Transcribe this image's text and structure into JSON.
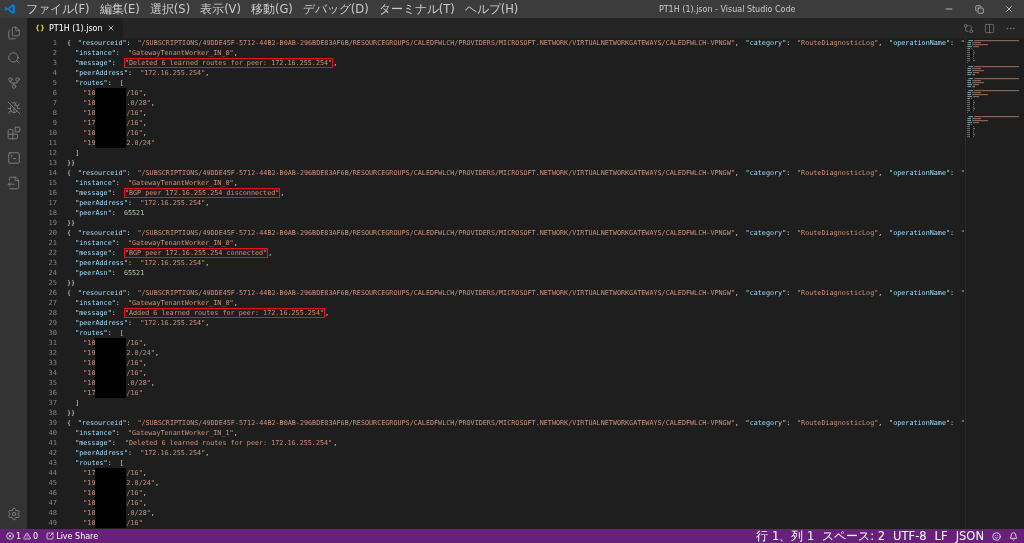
{
  "window": {
    "title": "PT1H (1).json - Visual Studio Code"
  },
  "menu": [
    "ファイル(F)",
    "編集(E)",
    "選択(S)",
    "表示(V)",
    "移動(G)",
    "デバッグ(D)",
    "ターミナル(T)",
    "ヘルプ(H)"
  ],
  "tabs": [
    {
      "icon": "{}",
      "label": "PT1H (1).json",
      "selected": true
    }
  ],
  "lines": [
    {
      "number": "1",
      "tokens": [
        {
          "kind": "punct",
          "text": "{"
        },
        {
          "kind": "indent"
        },
        {
          "kind": "key",
          "text": "\"resourceid\""
        },
        {
          "kind": "punct",
          "text": ":"
        },
        {
          "kind": "indent"
        },
        {
          "kind": "string",
          "text": "\"/SUBSCRIPTIONS/49DDE45F-5712-44B2-B0AB-296BDE83AF6B/RESOURCEGROUPS/CALEDFWLCH/PROVIDERS/MICROSOFT.NETWORK/VIRTUALNETWORKGATEWAYS/CALEDFWLCH-VPNGW\""
        },
        {
          "kind": "punct",
          "text": ","
        },
        {
          "kind": "indent"
        },
        {
          "kind": "key",
          "text": "\"category\""
        },
        {
          "kind": "punct",
          "text": ":"
        },
        {
          "kind": "indent"
        },
        {
          "kind": "string",
          "text": "\"RouteDiagnosticLog\""
        },
        {
          "kind": "punct",
          "text": ","
        },
        {
          "kind": "indent"
        },
        {
          "kind": "key",
          "text": "\"operationName\""
        },
        {
          "kind": "punct",
          "text": ":"
        },
        {
          "kind": "indent"
        },
        {
          "kind": "string",
          "text": "\""
        }
      ]
    },
    {
      "number": "2",
      "tokens": [
        {
          "kind": "indent"
        },
        {
          "kind": "key",
          "text": "\"instance\""
        },
        {
          "kind": "punct",
          "text": ":"
        },
        {
          "kind": "indent"
        },
        {
          "kind": "string",
          "text": "\"GatewayTenantWorker_IN_0\""
        },
        {
          "kind": "punct",
          "text": ","
        }
      ]
    },
    {
      "number": "3",
      "tokens": [
        {
          "kind": "indent"
        },
        {
          "kind": "key",
          "text": "\"message\""
        },
        {
          "kind": "punct",
          "text": ":"
        },
        {
          "kind": "indent"
        },
        {
          "kind": "string",
          "text": "\"Deleted 6 learned routes for peer: 172.16.255.254\"",
          "boxed": true
        },
        {
          "kind": "punct",
          "text": ","
        }
      ]
    },
    {
      "number": "4",
      "tokens": [
        {
          "kind": "indent"
        },
        {
          "kind": "key",
          "text": "\"peerAddress\""
        },
        {
          "kind": "punct",
          "text": ":"
        },
        {
          "kind": "indent"
        },
        {
          "kind": "string",
          "text": "\"172.16.255.254\""
        },
        {
          "kind": "punct",
          "text": ","
        }
      ]
    },
    {
      "number": "5",
      "tokens": [
        {
          "kind": "indent"
        },
        {
          "kind": "key",
          "text": "\"routes\""
        },
        {
          "kind": "punct",
          "text": ":"
        },
        {
          "kind": "indent"
        },
        {
          "kind": "punct",
          "text": "["
        }
      ]
    },
    {
      "number": "6",
      "tokens": [
        {
          "kind": "indent"
        },
        {
          "kind": "indent"
        },
        {
          "kind": "string",
          "text": "\"10"
        },
        {
          "kind": "redacted"
        },
        {
          "kind": "string",
          "text": "/16\""
        },
        {
          "kind": "punct",
          "text": ","
        }
      ]
    },
    {
      "number": "7",
      "tokens": [
        {
          "kind": "indent"
        },
        {
          "kind": "indent"
        },
        {
          "kind": "string",
          "text": "\"10"
        },
        {
          "kind": "redacted"
        },
        {
          "kind": "string",
          "text": ".0/28\""
        },
        {
          "kind": "punct",
          "text": ","
        }
      ]
    },
    {
      "number": "8",
      "tokens": [
        {
          "kind": "indent"
        },
        {
          "kind": "indent"
        },
        {
          "kind": "string",
          "text": "\"10"
        },
        {
          "kind": "redacted"
        },
        {
          "kind": "string",
          "text": "/16\""
        },
        {
          "kind": "punct",
          "text": ","
        }
      ]
    },
    {
      "number": "9",
      "tokens": [
        {
          "kind": "indent"
        },
        {
          "kind": "indent"
        },
        {
          "kind": "string",
          "text": "\"17"
        },
        {
          "kind": "redacted"
        },
        {
          "kind": "string",
          "text": "/16\""
        },
        {
          "kind": "punct",
          "text": ","
        }
      ]
    },
    {
      "number": "10",
      "tokens": [
        {
          "kind": "indent"
        },
        {
          "kind": "indent"
        },
        {
          "kind": "string",
          "text": "\"10"
        },
        {
          "kind": "redacted"
        },
        {
          "kind": "string",
          "text": "/16\""
        },
        {
          "kind": "punct",
          "text": ","
        }
      ]
    },
    {
      "number": "11",
      "tokens": [
        {
          "kind": "indent"
        },
        {
          "kind": "indent"
        },
        {
          "kind": "string",
          "text": "\"19"
        },
        {
          "kind": "redacted"
        },
        {
          "kind": "string",
          "text": "2.0/24\""
        }
      ]
    },
    {
      "number": "12",
      "tokens": [
        {
          "kind": "indent"
        },
        {
          "kind": "punct",
          "text": "]"
        }
      ]
    },
    {
      "number": "13",
      "tokens": [
        {
          "kind": "punct",
          "text": "}}"
        }
      ]
    },
    {
      "number": "14",
      "tokens": [
        {
          "kind": "punct",
          "text": "{"
        },
        {
          "kind": "indent"
        },
        {
          "kind": "key",
          "text": "\"resourceid\""
        },
        {
          "kind": "punct",
          "text": ":"
        },
        {
          "kind": "indent"
        },
        {
          "kind": "string",
          "text": "\"/SUBSCRIPTIONS/49DDE45F-5712-44B2-B0AB-296BDE83AF6B/RESOURCEGROUPS/CALEDFWLCH/PROVIDERS/MICROSOFT.NETWORK/VIRTUALNETWORKGATEWAYS/CALEDFWLCH-VPNGW\""
        },
        {
          "kind": "punct",
          "text": ","
        },
        {
          "kind": "indent"
        },
        {
          "kind": "key",
          "text": "\"category\""
        },
        {
          "kind": "punct",
          "text": ":"
        },
        {
          "kind": "indent"
        },
        {
          "kind": "string",
          "text": "\"RouteDiagnosticLog\""
        },
        {
          "kind": "punct",
          "text": ","
        },
        {
          "kind": "indent"
        },
        {
          "kind": "key",
          "text": "\"operationName\""
        },
        {
          "kind": "punct",
          "text": ":"
        },
        {
          "kind": "indent"
        },
        {
          "kind": "string",
          "text": "\""
        }
      ]
    },
    {
      "number": "15",
      "tokens": [
        {
          "kind": "indent"
        },
        {
          "kind": "key",
          "text": "\"instance\""
        },
        {
          "kind": "punct",
          "text": ":"
        },
        {
          "kind": "indent"
        },
        {
          "kind": "string",
          "text": "\"GatewayTenantWorker_IN_0\""
        },
        {
          "kind": "punct",
          "text": ","
        }
      ]
    },
    {
      "number": "16",
      "tokens": [
        {
          "kind": "indent"
        },
        {
          "kind": "key",
          "text": "\"message\""
        },
        {
          "kind": "punct",
          "text": ":"
        },
        {
          "kind": "indent"
        },
        {
          "kind": "string",
          "text": "\"BGP peer 172.16.255.254 disconnected\"",
          "boxed": true
        },
        {
          "kind": "punct",
          "text": ","
        }
      ]
    },
    {
      "number": "17",
      "tokens": [
        {
          "kind": "indent"
        },
        {
          "kind": "key",
          "text": "\"peerAddress\""
        },
        {
          "kind": "punct",
          "text": ":"
        },
        {
          "kind": "indent"
        },
        {
          "kind": "string",
          "text": "\"172.16.255.254\""
        },
        {
          "kind": "punct",
          "text": ","
        }
      ]
    },
    {
      "number": "18",
      "tokens": [
        {
          "kind": "indent"
        },
        {
          "kind": "key",
          "text": "\"peerAsn\""
        },
        {
          "kind": "punct",
          "text": ":"
        },
        {
          "kind": "indent"
        },
        {
          "kind": "number",
          "text": "65521"
        }
      ]
    },
    {
      "number": "19",
      "tokens": [
        {
          "kind": "punct",
          "text": "}}"
        }
      ]
    },
    {
      "number": "20",
      "tokens": [
        {
          "kind": "punct",
          "text": "{"
        },
        {
          "kind": "indent"
        },
        {
          "kind": "key",
          "text": "\"resourceid\""
        },
        {
          "kind": "punct",
          "text": ":"
        },
        {
          "kind": "indent"
        },
        {
          "kind": "string",
          "text": "\"/SUBSCRIPTIONS/49DDE45F-5712-44B2-B0AB-296BDE83AF6B/RESOURCEGROUPS/CALEDFWLCH/PROVIDERS/MICROSOFT.NETWORK/VIRTUALNETWORKGATEWAYS/CALEDFWLCH-VPNGW\""
        },
        {
          "kind": "punct",
          "text": ","
        },
        {
          "kind": "indent"
        },
        {
          "kind": "key",
          "text": "\"category\""
        },
        {
          "kind": "punct",
          "text": ":"
        },
        {
          "kind": "indent"
        },
        {
          "kind": "string",
          "text": "\"RouteDiagnosticLog\""
        },
        {
          "kind": "punct",
          "text": ","
        },
        {
          "kind": "indent"
        },
        {
          "kind": "key",
          "text": "\"operationName\""
        },
        {
          "kind": "punct",
          "text": ":"
        },
        {
          "kind": "indent"
        },
        {
          "kind": "string",
          "text": "\""
        }
      ]
    },
    {
      "number": "21",
      "tokens": [
        {
          "kind": "indent"
        },
        {
          "kind": "key",
          "text": "\"instance\""
        },
        {
          "kind": "punct",
          "text": ":"
        },
        {
          "kind": "indent"
        },
        {
          "kind": "string",
          "text": "\"GatewayTenantWorker_IN_0\""
        },
        {
          "kind": "punct",
          "text": ","
        }
      ]
    },
    {
      "number": "22",
      "tokens": [
        {
          "kind": "indent"
        },
        {
          "kind": "key",
          "text": "\"message\""
        },
        {
          "kind": "punct",
          "text": ":"
        },
        {
          "kind": "indent"
        },
        {
          "kind": "string",
          "text": "\"BGP peer 172.16.255.254 connected\"",
          "boxed": true
        },
        {
          "kind": "punct",
          "text": ","
        }
      ]
    },
    {
      "number": "23",
      "tokens": [
        {
          "kind": "indent"
        },
        {
          "kind": "key",
          "text": "\"peerAddress\""
        },
        {
          "kind": "punct",
          "text": ":"
        },
        {
          "kind": "indent"
        },
        {
          "kind": "string",
          "text": "\"172.16.255.254\""
        },
        {
          "kind": "punct",
          "text": ","
        }
      ]
    },
    {
      "number": "24",
      "tokens": [
        {
          "kind": "indent"
        },
        {
          "kind": "key",
          "text": "\"peerAsn\""
        },
        {
          "kind": "punct",
          "text": ":"
        },
        {
          "kind": "indent"
        },
        {
          "kind": "number",
          "text": "65521"
        }
      ]
    },
    {
      "number": "25",
      "tokens": [
        {
          "kind": "punct",
          "text": "}}"
        }
      ]
    },
    {
      "number": "26",
      "tokens": [
        {
          "kind": "punct",
          "text": "{"
        },
        {
          "kind": "indent"
        },
        {
          "kind": "key",
          "text": "\"resourceid\""
        },
        {
          "kind": "punct",
          "text": ":"
        },
        {
          "kind": "indent"
        },
        {
          "kind": "string",
          "text": "\"/SUBSCRIPTIONS/49DDE45F-5712-44B2-B0AB-296BDE83AF6B/RESOURCEGROUPS/CALEDFWLCH/PROVIDERS/MICROSOFT.NETWORK/VIRTUALNETWORKGATEWAYS/CALEDFWLCH-VPNGW\""
        },
        {
          "kind": "punct",
          "text": ","
        },
        {
          "kind": "indent"
        },
        {
          "kind": "key",
          "text": "\"category\""
        },
        {
          "kind": "punct",
          "text": ":"
        },
        {
          "kind": "indent"
        },
        {
          "kind": "string",
          "text": "\"RouteDiagnosticLog\""
        },
        {
          "kind": "punct",
          "text": ","
        },
        {
          "kind": "indent"
        },
        {
          "kind": "key",
          "text": "\"operationName\""
        },
        {
          "kind": "punct",
          "text": ":"
        },
        {
          "kind": "indent"
        },
        {
          "kind": "string",
          "text": "\""
        }
      ]
    },
    {
      "number": "27",
      "tokens": [
        {
          "kind": "indent"
        },
        {
          "kind": "key",
          "text": "\"instance\""
        },
        {
          "kind": "punct",
          "text": ":"
        },
        {
          "kind": "indent"
        },
        {
          "kind": "string",
          "text": "\"GatewayTenantWorker_IN_0\""
        },
        {
          "kind": "punct",
          "text": ","
        }
      ]
    },
    {
      "number": "28",
      "tokens": [
        {
          "kind": "indent"
        },
        {
          "kind": "key",
          "text": "\"message\""
        },
        {
          "kind": "punct",
          "text": ":"
        },
        {
          "kind": "indent"
        },
        {
          "kind": "string",
          "text": "\"Added 6 learned routes for peer: 172.16.255.254\"",
          "boxed": true
        },
        {
          "kind": "punct",
          "text": ","
        }
      ]
    },
    {
      "number": "29",
      "tokens": [
        {
          "kind": "indent"
        },
        {
          "kind": "key",
          "text": "\"peerAddress\""
        },
        {
          "kind": "punct",
          "text": ":"
        },
        {
          "kind": "indent"
        },
        {
          "kind": "string",
          "text": "\"172.16.255.254\""
        },
        {
          "kind": "punct",
          "text": ","
        }
      ]
    },
    {
      "number": "30",
      "tokens": [
        {
          "kind": "indent"
        },
        {
          "kind": "key",
          "text": "\"routes\""
        },
        {
          "kind": "punct",
          "text": ":"
        },
        {
          "kind": "indent"
        },
        {
          "kind": "punct",
          "text": "["
        }
      ]
    },
    {
      "number": "31",
      "tokens": [
        {
          "kind": "indent"
        },
        {
          "kind": "indent"
        },
        {
          "kind": "string",
          "text": "\"10"
        },
        {
          "kind": "redacted"
        },
        {
          "kind": "string",
          "text": "/16\""
        },
        {
          "kind": "punct",
          "text": ","
        }
      ]
    },
    {
      "number": "32",
      "tokens": [
        {
          "kind": "indent"
        },
        {
          "kind": "indent"
        },
        {
          "kind": "string",
          "text": "\"19"
        },
        {
          "kind": "redacted"
        },
        {
          "kind": "string",
          "text": "2.0/24\""
        },
        {
          "kind": "punct",
          "text": ","
        }
      ]
    },
    {
      "number": "33",
      "tokens": [
        {
          "kind": "indent"
        },
        {
          "kind": "indent"
        },
        {
          "kind": "string",
          "text": "\"10"
        },
        {
          "kind": "redacted"
        },
        {
          "kind": "string",
          "text": "/16\""
        },
        {
          "kind": "punct",
          "text": ","
        }
      ]
    },
    {
      "number": "34",
      "tokens": [
        {
          "kind": "indent"
        },
        {
          "kind": "indent"
        },
        {
          "kind": "string",
          "text": "\"10"
        },
        {
          "kind": "redacted"
        },
        {
          "kind": "string",
          "text": "/16\""
        },
        {
          "kind": "punct",
          "text": ","
        }
      ]
    },
    {
      "number": "35",
      "tokens": [
        {
          "kind": "indent"
        },
        {
          "kind": "indent"
        },
        {
          "kind": "string",
          "text": "\"10"
        },
        {
          "kind": "redacted"
        },
        {
          "kind": "string",
          "text": ".0/28\""
        },
        {
          "kind": "punct",
          "text": ","
        }
      ]
    },
    {
      "number": "36",
      "tokens": [
        {
          "kind": "indent"
        },
        {
          "kind": "indent"
        },
        {
          "kind": "string",
          "text": "\"17"
        },
        {
          "kind": "redacted"
        },
        {
          "kind": "string",
          "text": "/16\""
        }
      ]
    },
    {
      "number": "37",
      "tokens": [
        {
          "kind": "indent"
        },
        {
          "kind": "punct",
          "text": "]"
        }
      ]
    },
    {
      "number": "38",
      "tokens": [
        {
          "kind": "punct",
          "text": "}}"
        }
      ]
    },
    {
      "number": "39",
      "tokens": [
        {
          "kind": "punct",
          "text": "{"
        },
        {
          "kind": "indent"
        },
        {
          "kind": "key",
          "text": "\"resourceid\""
        },
        {
          "kind": "punct",
          "text": ":"
        },
        {
          "kind": "indent"
        },
        {
          "kind": "string",
          "text": "\"/SUBSCRIPTIONS/49DDE45F-5712-44B2-B0AB-296BDE83AF6B/RESOURCEGROUPS/CALEDFWLCH/PROVIDERS/MICROSOFT.NETWORK/VIRTUALNETWORKGATEWAYS/CALEDFWLCH-VPNGW\""
        },
        {
          "kind": "punct",
          "text": ","
        },
        {
          "kind": "indent"
        },
        {
          "kind": "key",
          "text": "\"category\""
        },
        {
          "kind": "punct",
          "text": ":"
        },
        {
          "kind": "indent"
        },
        {
          "kind": "string",
          "text": "\"RouteDiagnosticLog\""
        },
        {
          "kind": "punct",
          "text": ","
        },
        {
          "kind": "indent"
        },
        {
          "kind": "key",
          "text": "\"operationName\""
        },
        {
          "kind": "punct",
          "text": ":"
        },
        {
          "kind": "indent"
        },
        {
          "kind": "string",
          "text": "\""
        }
      ]
    },
    {
      "number": "40",
      "tokens": [
        {
          "kind": "indent"
        },
        {
          "kind": "key",
          "text": "\"instance\""
        },
        {
          "kind": "punct",
          "text": ":"
        },
        {
          "kind": "indent"
        },
        {
          "kind": "string",
          "text": "\"GatewayTenantWorker_IN_1\""
        },
        {
          "kind": "punct",
          "text": ","
        }
      ]
    },
    {
      "number": "41",
      "tokens": [
        {
          "kind": "indent"
        },
        {
          "kind": "key",
          "text": "\"message\""
        },
        {
          "kind": "punct",
          "text": ":"
        },
        {
          "kind": "indent"
        },
        {
          "kind": "string",
          "text": "\"Deleted 6 learned routes for peer: 172.16.255.254\"",
          "boxed": false
        },
        {
          "kind": "punct",
          "text": ","
        }
      ]
    },
    {
      "number": "42",
      "tokens": [
        {
          "kind": "indent"
        },
        {
          "kind": "key",
          "text": "\"peerAddress\""
        },
        {
          "kind": "punct",
          "text": ":"
        },
        {
          "kind": "indent"
        },
        {
          "kind": "string",
          "text": "\"172.16.255.254\""
        },
        {
          "kind": "punct",
          "text": ","
        }
      ]
    },
    {
      "number": "43",
      "tokens": [
        {
          "kind": "indent"
        },
        {
          "kind": "key",
          "text": "\"routes\""
        },
        {
          "kind": "punct",
          "text": ":"
        },
        {
          "kind": "indent"
        },
        {
          "kind": "punct",
          "text": "["
        }
      ]
    },
    {
      "number": "44",
      "tokens": [
        {
          "kind": "indent"
        },
        {
          "kind": "indent"
        },
        {
          "kind": "string",
          "text": "\"17"
        },
        {
          "kind": "redacted"
        },
        {
          "kind": "string",
          "text": "/16\""
        },
        {
          "kind": "punct",
          "text": ","
        }
      ]
    },
    {
      "number": "45",
      "tokens": [
        {
          "kind": "indent"
        },
        {
          "kind": "indent"
        },
        {
          "kind": "string",
          "text": "\"19"
        },
        {
          "kind": "redacted"
        },
        {
          "kind": "string",
          "text": "2.0/24\""
        },
        {
          "kind": "punct",
          "text": ","
        }
      ]
    },
    {
      "number": "46",
      "tokens": [
        {
          "kind": "indent"
        },
        {
          "kind": "indent"
        },
        {
          "kind": "string",
          "text": "\"10"
        },
        {
          "kind": "redacted"
        },
        {
          "kind": "string",
          "text": "/16\""
        },
        {
          "kind": "punct",
          "text": ","
        }
      ]
    },
    {
      "number": "47",
      "tokens": [
        {
          "kind": "indent"
        },
        {
          "kind": "indent"
        },
        {
          "kind": "string",
          "text": "\"10"
        },
        {
          "kind": "redacted"
        },
        {
          "kind": "string",
          "text": "/16\""
        },
        {
          "kind": "punct",
          "text": ","
        }
      ]
    },
    {
      "number": "48",
      "tokens": [
        {
          "kind": "indent"
        },
        {
          "kind": "indent"
        },
        {
          "kind": "string",
          "text": "\"10"
        },
        {
          "kind": "redacted"
        },
        {
          "kind": "string",
          "text": ".0/28\""
        },
        {
          "kind": "punct",
          "text": ","
        }
      ]
    },
    {
      "number": "49",
      "tokens": [
        {
          "kind": "indent"
        },
        {
          "kind": "indent"
        },
        {
          "kind": "string",
          "text": "\"10"
        },
        {
          "kind": "redacted"
        },
        {
          "kind": "string",
          "text": "/16\""
        }
      ]
    }
  ],
  "status_bar": {
    "errors": "1",
    "warnings": "0",
    "live_share": "Live Share",
    "items": [
      "行 1、列 1",
      "スペース: 2",
      "UTF-8",
      "LF",
      "JSON"
    ]
  }
}
